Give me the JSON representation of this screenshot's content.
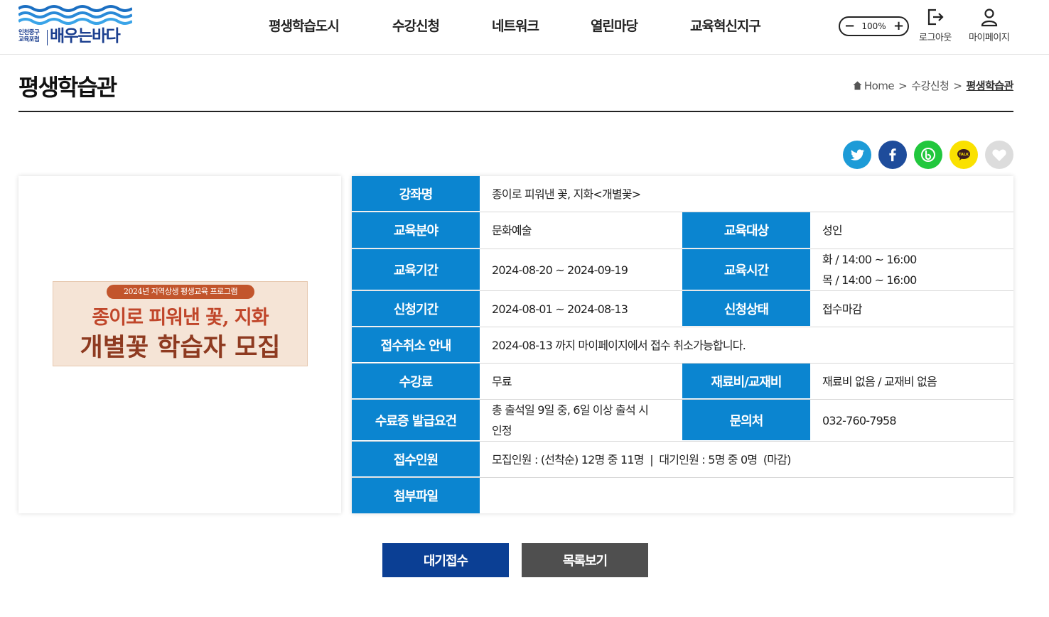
{
  "header": {
    "logo": {
      "small_line1": "인천중구",
      "small_line2": "교육포럼",
      "brand": "배우는바다"
    },
    "nav": [
      "평생학습도시",
      "수강신청",
      "네트워크",
      "열린마당",
      "교육혁신지구"
    ],
    "zoom": {
      "minus": "−",
      "value": "100%",
      "plus": "+"
    },
    "logout_label": "로그아웃",
    "mypage_label": "마이페이지"
  },
  "page": {
    "title": "평생학습관",
    "breadcrumb": {
      "home": "Home",
      "sep": ">",
      "level1": "수강신청",
      "current": "평생학습관"
    }
  },
  "share": [
    {
      "name": "twitter",
      "color": "#1d9bd7"
    },
    {
      "name": "facebook",
      "color": "#1e4c9b"
    },
    {
      "name": "band",
      "color": "#21c73d"
    },
    {
      "name": "kakaotalk",
      "color": "#fae100"
    },
    {
      "name": "like",
      "color": "#dcdcdc"
    }
  ],
  "poster": {
    "tag": "2024년 지역상생 평생교육 프로그램",
    "line1": "종이로 피워낸 꽃, 지화",
    "line2": "개별꽃 학습자 모집"
  },
  "course": {
    "name_label": "강좌명",
    "name": "종이로 피워낸 꽃, 지화<개별꽃>",
    "field_label": "교육분야",
    "field": "문화예술",
    "target_label": "교육대상",
    "target": "성인",
    "period_label": "교육기간",
    "period": "2024-08-20 ~ 2024-09-19",
    "time_label": "교육시간",
    "time_line1": "화 / 14:00 ~ 16:00",
    "time_line2": "목 / 14:00 ~ 16:00",
    "apply_label": "신청기간",
    "apply": "2024-08-01 ~ 2024-08-13",
    "status_label": "신청상태",
    "status": "접수마감",
    "cancel_label": "접수취소 안내",
    "cancel": "2024-08-13 까지 마이페이지에서 접수 취소가능합니다.",
    "fee_label": "수강료",
    "fee": "무료",
    "material_label": "재료비/교재비",
    "material": "재료비 없음 / 교재비 없음",
    "cert_label": "수료증 발급요건",
    "cert_line1": "총 출석일 9일 중, 6일 이상 출석 시",
    "cert_line2": "인정",
    "contact_label": "문의처",
    "contact": "032-760-7958",
    "enroll_label": "접수인원",
    "enroll": "모집인원 : (선착순) 12명 중 11명  |  대기인원 : 5명 중 0명  (마감)",
    "file_label": "첨부파일",
    "file": ""
  },
  "buttons": {
    "wait": "대기접수",
    "list": "목록보기"
  },
  "colors": {
    "th": "#0b85d0",
    "wait_btn": "#0b3f94",
    "list_btn": "#4f4f4f",
    "brand": "#1b3f8f"
  }
}
